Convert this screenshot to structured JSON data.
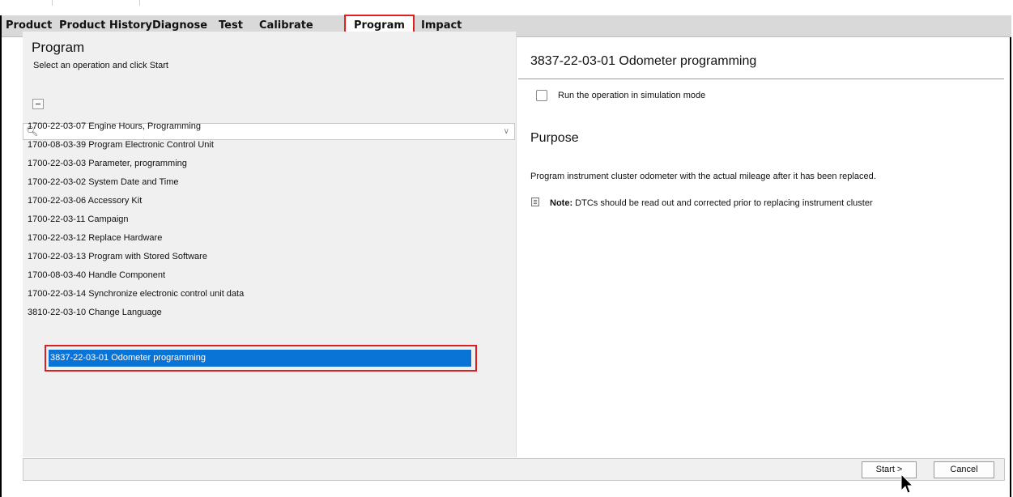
{
  "tabs": [
    "Product",
    "Product History",
    "Diagnose",
    "Test",
    "Calibrate",
    "Program",
    "Impact"
  ],
  "active_tab": "Program",
  "left_pane": {
    "title": "Program",
    "subtitle": "Select an operation and click Start",
    "search": {
      "value": "",
      "placeholder": ""
    },
    "operations": [
      "1700-22-03-07  Engine Hours, Programming",
      "1700-08-03-39 Program Electronic Control Unit",
      "1700-22-03-03 Parameter, programming",
      "1700-22-03-02 System Date and Time",
      "1700-22-03-06 Accessory Kit",
      "1700-22-03-11 Campaign",
      "1700-22-03-12 Replace Hardware",
      "1700-22-03-13 Program with Stored Software",
      "1700-08-03-40 Handle Component",
      "1700-22-03-14 Synchronize electronic control unit data",
      "3810-22-03-10 Change Language"
    ],
    "selected_operation": "3837-22-03-01 Odometer programming"
  },
  "right_pane": {
    "title": "3837-22-03-01 Odometer programming",
    "simulation_label": "Run the operation in simulation mode",
    "simulation_checked": false,
    "purpose_heading": "Purpose",
    "purpose_text": "Program instrument cluster odometer with the actual mileage after it has been replaced.",
    "note_label": "Note:",
    "note_text": " DTCs should be read out and corrected prior to replacing instrument cluster"
  },
  "buttons": {
    "start": "Start >",
    "cancel": "Cancel"
  },
  "colors": {
    "selection": "#0a74d6",
    "highlight_outline": "#e02020",
    "tab_bar": "#d9d9d9",
    "pane_background": "#f0f0f0"
  },
  "icons": [
    "search-icon",
    "chevron-down-icon",
    "collapse-icon",
    "note-icon",
    "mouse-cursor-icon"
  ]
}
